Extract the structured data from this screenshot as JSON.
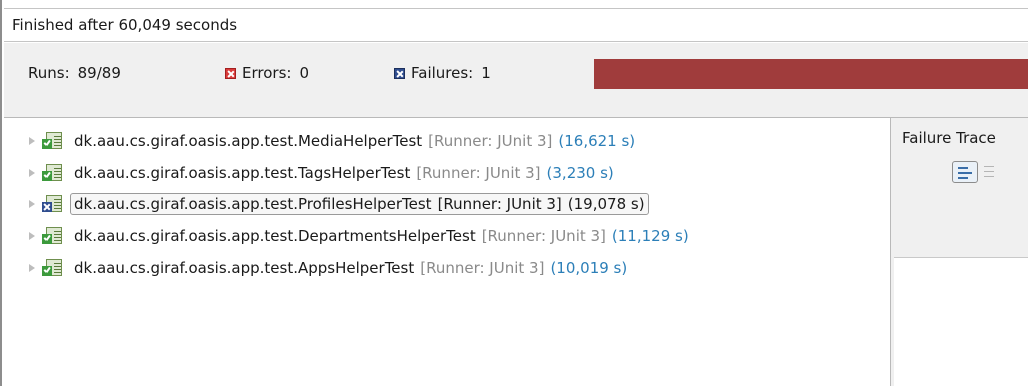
{
  "header": {
    "status": "Finished after 60,049 seconds"
  },
  "counters": {
    "runs_label": "Runs:",
    "runs_value": "89/89",
    "errors_label": "Errors:",
    "errors_value": "0",
    "failures_label": "Failures:",
    "failures_value": "1"
  },
  "progress": {
    "fraction": 1.0,
    "color": "#a03c3c"
  },
  "tests": [
    {
      "name": "dk.aau.cs.giraf.oasis.app.test.MediaHelperTest",
      "runner": "[Runner: JUnit 3]",
      "time": "(16,621 s)",
      "status": "passed",
      "icon": "test-passed-icon"
    },
    {
      "name": "dk.aau.cs.giraf.oasis.app.test.TagsHelperTest",
      "runner": "[Runner: JUnit 3]",
      "time": "(3,230 s)",
      "status": "passed",
      "icon": "test-passed-icon"
    },
    {
      "name": "dk.aau.cs.giraf.oasis.app.test.ProfilesHelperTest",
      "runner": "[Runner: JUnit 3]",
      "time": "(19,078 s)",
      "status": "failed",
      "icon": "test-failed-icon"
    },
    {
      "name": "dk.aau.cs.giraf.oasis.app.test.DepartmentsHelperTest",
      "runner": "[Runner: JUnit 3]",
      "time": "(11,129 s)",
      "status": "passed",
      "icon": "test-passed-icon"
    },
    {
      "name": "dk.aau.cs.giraf.oasis.app.test.AppsHelperTest",
      "runner": "[Runner: JUnit 3]",
      "time": "(10,019 s)",
      "status": "passed",
      "icon": "test-passed-icon"
    }
  ],
  "trace": {
    "title": "Failure Trace",
    "filter_icon": "filter-stack-trace-icon",
    "compare_icon": "compare-result-icon"
  },
  "colors": {
    "error": "#d93b3b",
    "failure": "#2f4d8f",
    "passed": "#3c9a3c",
    "time_text": "#2c7fb8",
    "runner_text": "#8a8a8a"
  }
}
